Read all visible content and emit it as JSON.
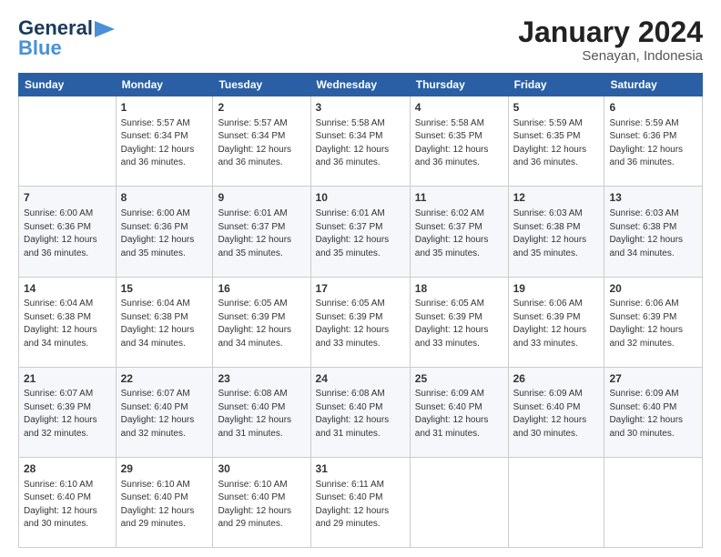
{
  "logo": {
    "line1": "General",
    "line2": "Blue",
    "icon": "▶"
  },
  "calendar": {
    "title": "January 2024",
    "subtitle": "Senayan, Indonesia",
    "days_of_week": [
      "Sunday",
      "Monday",
      "Tuesday",
      "Wednesday",
      "Thursday",
      "Friday",
      "Saturday"
    ],
    "weeks": [
      [
        {
          "day": "",
          "empty": true
        },
        {
          "day": "1",
          "sunrise": "5:57 AM",
          "sunset": "6:34 PM",
          "daylight": "12 hours and 36 minutes."
        },
        {
          "day": "2",
          "sunrise": "5:57 AM",
          "sunset": "6:34 PM",
          "daylight": "12 hours and 36 minutes."
        },
        {
          "day": "3",
          "sunrise": "5:58 AM",
          "sunset": "6:34 PM",
          "daylight": "12 hours and 36 minutes."
        },
        {
          "day": "4",
          "sunrise": "5:58 AM",
          "sunset": "6:35 PM",
          "daylight": "12 hours and 36 minutes."
        },
        {
          "day": "5",
          "sunrise": "5:59 AM",
          "sunset": "6:35 PM",
          "daylight": "12 hours and 36 minutes."
        },
        {
          "day": "6",
          "sunrise": "5:59 AM",
          "sunset": "6:36 PM",
          "daylight": "12 hours and 36 minutes."
        }
      ],
      [
        {
          "day": "7",
          "sunrise": "6:00 AM",
          "sunset": "6:36 PM",
          "daylight": "12 hours and 36 minutes."
        },
        {
          "day": "8",
          "sunrise": "6:00 AM",
          "sunset": "6:36 PM",
          "daylight": "12 hours and 35 minutes."
        },
        {
          "day": "9",
          "sunrise": "6:01 AM",
          "sunset": "6:37 PM",
          "daylight": "12 hours and 35 minutes."
        },
        {
          "day": "10",
          "sunrise": "6:01 AM",
          "sunset": "6:37 PM",
          "daylight": "12 hours and 35 minutes."
        },
        {
          "day": "11",
          "sunrise": "6:02 AM",
          "sunset": "6:37 PM",
          "daylight": "12 hours and 35 minutes."
        },
        {
          "day": "12",
          "sunrise": "6:03 AM",
          "sunset": "6:38 PM",
          "daylight": "12 hours and 35 minutes."
        },
        {
          "day": "13",
          "sunrise": "6:03 AM",
          "sunset": "6:38 PM",
          "daylight": "12 hours and 34 minutes."
        }
      ],
      [
        {
          "day": "14",
          "sunrise": "6:04 AM",
          "sunset": "6:38 PM",
          "daylight": "12 hours and 34 minutes."
        },
        {
          "day": "15",
          "sunrise": "6:04 AM",
          "sunset": "6:38 PM",
          "daylight": "12 hours and 34 minutes."
        },
        {
          "day": "16",
          "sunrise": "6:05 AM",
          "sunset": "6:39 PM",
          "daylight": "12 hours and 34 minutes."
        },
        {
          "day": "17",
          "sunrise": "6:05 AM",
          "sunset": "6:39 PM",
          "daylight": "12 hours and 33 minutes."
        },
        {
          "day": "18",
          "sunrise": "6:05 AM",
          "sunset": "6:39 PM",
          "daylight": "12 hours and 33 minutes."
        },
        {
          "day": "19",
          "sunrise": "6:06 AM",
          "sunset": "6:39 PM",
          "daylight": "12 hours and 33 minutes."
        },
        {
          "day": "20",
          "sunrise": "6:06 AM",
          "sunset": "6:39 PM",
          "daylight": "12 hours and 32 minutes."
        }
      ],
      [
        {
          "day": "21",
          "sunrise": "6:07 AM",
          "sunset": "6:39 PM",
          "daylight": "12 hours and 32 minutes."
        },
        {
          "day": "22",
          "sunrise": "6:07 AM",
          "sunset": "6:40 PM",
          "daylight": "12 hours and 32 minutes."
        },
        {
          "day": "23",
          "sunrise": "6:08 AM",
          "sunset": "6:40 PM",
          "daylight": "12 hours and 31 minutes."
        },
        {
          "day": "24",
          "sunrise": "6:08 AM",
          "sunset": "6:40 PM",
          "daylight": "12 hours and 31 minutes."
        },
        {
          "day": "25",
          "sunrise": "6:09 AM",
          "sunset": "6:40 PM",
          "daylight": "12 hours and 31 minutes."
        },
        {
          "day": "26",
          "sunrise": "6:09 AM",
          "sunset": "6:40 PM",
          "daylight": "12 hours and 30 minutes."
        },
        {
          "day": "27",
          "sunrise": "6:09 AM",
          "sunset": "6:40 PM",
          "daylight": "12 hours and 30 minutes."
        }
      ],
      [
        {
          "day": "28",
          "sunrise": "6:10 AM",
          "sunset": "6:40 PM",
          "daylight": "12 hours and 30 minutes."
        },
        {
          "day": "29",
          "sunrise": "6:10 AM",
          "sunset": "6:40 PM",
          "daylight": "12 hours and 29 minutes."
        },
        {
          "day": "30",
          "sunrise": "6:10 AM",
          "sunset": "6:40 PM",
          "daylight": "12 hours and 29 minutes."
        },
        {
          "day": "31",
          "sunrise": "6:11 AM",
          "sunset": "6:40 PM",
          "daylight": "12 hours and 29 minutes."
        },
        {
          "day": "",
          "empty": true
        },
        {
          "day": "",
          "empty": true
        },
        {
          "day": "",
          "empty": true
        }
      ]
    ]
  }
}
